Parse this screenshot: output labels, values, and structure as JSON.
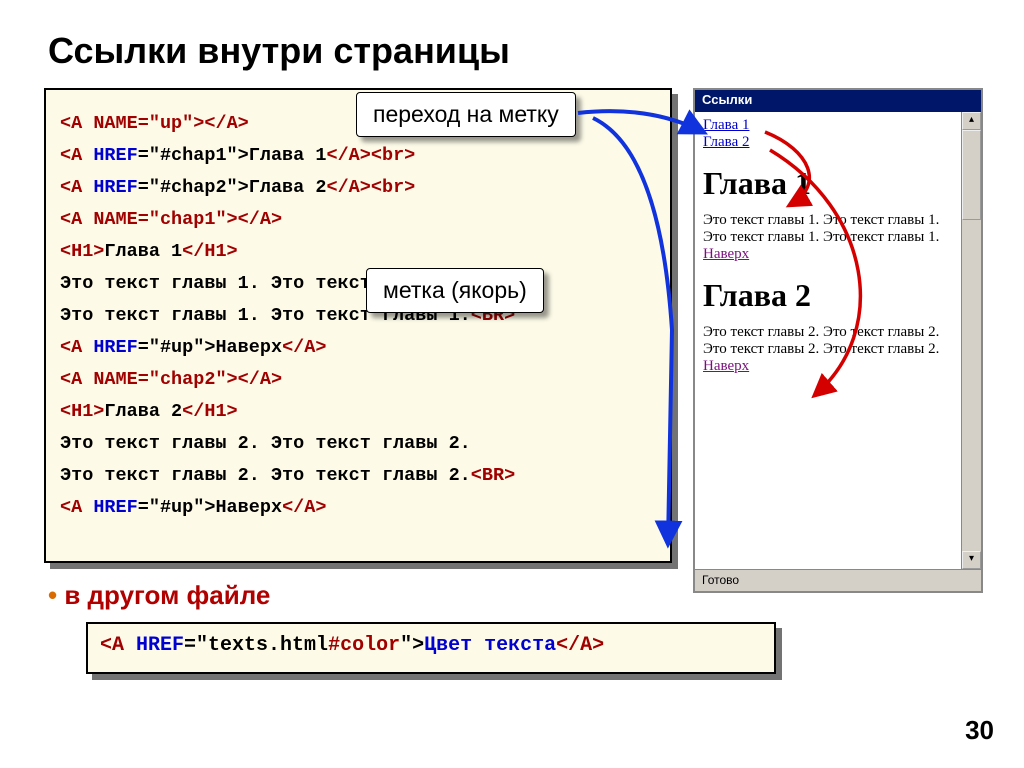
{
  "title": "Ссылки внутри страницы",
  "code": {
    "l1_a": "<A",
    "l1_b": " NAME",
    "l1_c": "=\"up\">",
    "l1_d": "</A>",
    "l2_a": "<A",
    "l2_b": " HREF",
    "l2_c": "=\"#chap1\">Глава 1",
    "l2_d": "</A><br>",
    "l3_a": "<A",
    "l3_b": " HREF",
    "l3_c": "=\"#chap2\">Глава 2",
    "l3_d": "</A><br>",
    "l4_a": "<A",
    "l4_b": " NAME",
    "l4_c": "=\"chap1\">",
    "l4_d": "</A>",
    "l5_a": "<H1>",
    "l5_b": "Глава 1",
    "l5_c": "</H1>",
    "l6": "Это текст главы 1. Это текст главы 1.",
    "l7_a": "Это текст главы 1. Это текст главы 1.",
    "l7_b": "<BR>",
    "l8_a": "<A",
    "l8_b": " HREF",
    "l8_c": "=\"#up\">Наверх",
    "l8_d": "</A>",
    "l9_a": "<A",
    "l9_b": " NAME",
    "l9_c": "=\"chap2\">",
    "l9_d": "</A>",
    "l10_a": "<H1>",
    "l10_b": "Глава 2",
    "l10_c": "</H1>",
    "l11": "Это текст главы 2. Это текст главы 2.",
    "l12_a": "Это текст главы 2. Это текст главы 2.",
    "l12_b": "<BR>",
    "l13_a": "<A",
    "l13_b": " HREF",
    "l13_c": "=\"#up\">Наверх",
    "l13_d": "</A>"
  },
  "callout1": "переход на метку",
  "callout2": "метка (якорь)",
  "bullet": "в другом файле",
  "code2": {
    "a": "<A",
    "b": " HREF",
    "c": "=\"texts.html",
    "d": "#color",
    "e": "\">",
    "f": "Цвет текста",
    "g": "</A>"
  },
  "browser": {
    "title": "Ссылки",
    "link1": "Глава 1",
    "link2": "Глава 2",
    "h1a": "Глава 1",
    "txt1": "Это текст главы 1. Это текст главы 1. Это текст главы 1. Это текст главы 1.",
    "up1": "Наверх",
    "h1b": "Глава 2",
    "txt2": "Это текст главы 2. Это текст главы 2. Это текст главы 2. Это текст главы 2.",
    "up2": "Наверх",
    "status": "Готово"
  },
  "pageNum": "30"
}
